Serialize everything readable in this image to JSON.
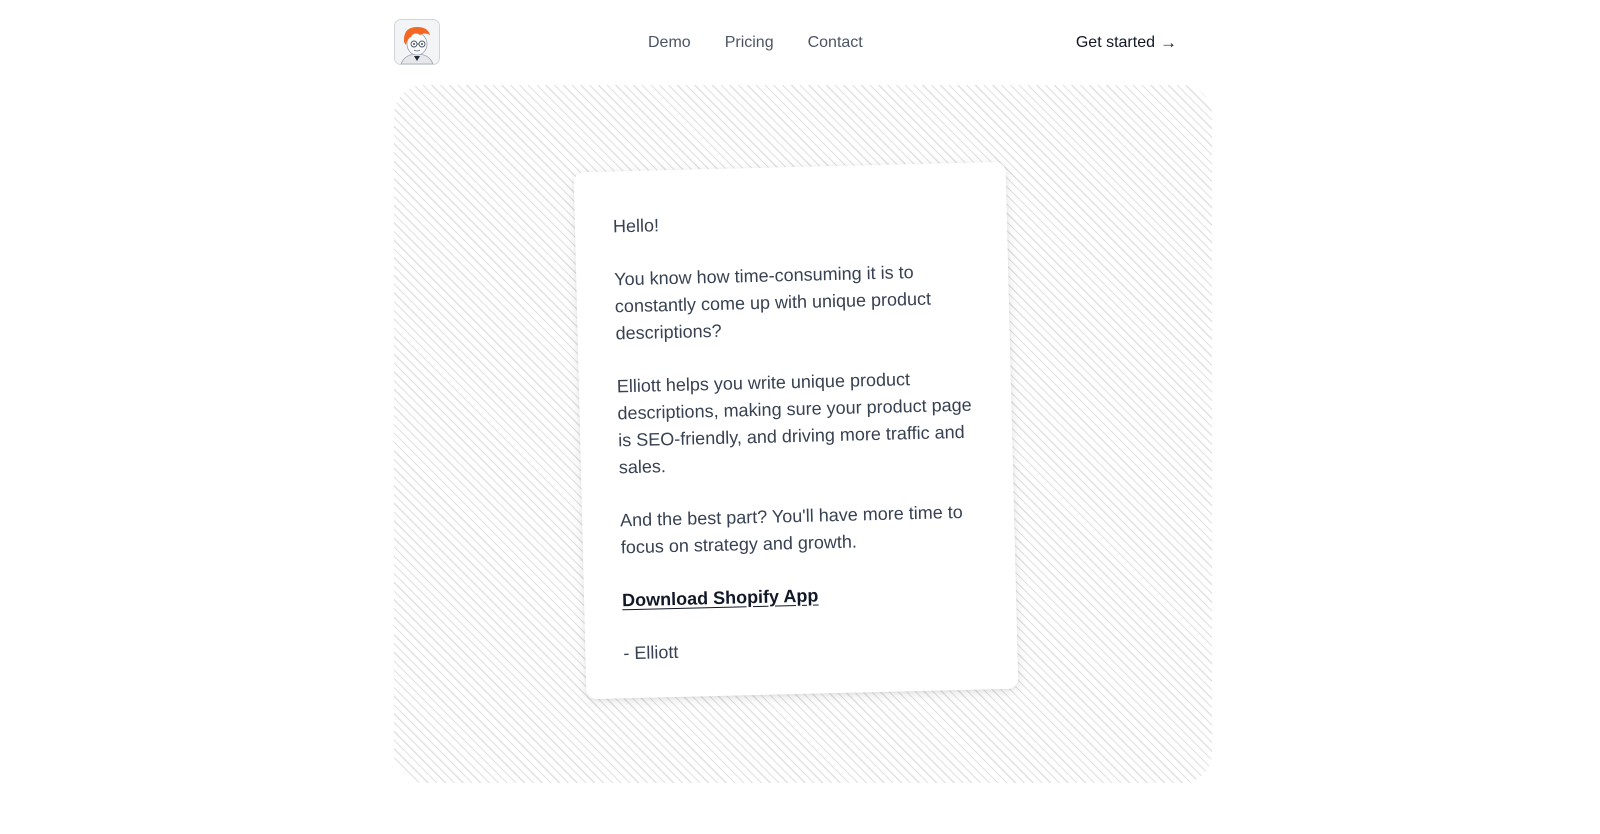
{
  "nav": {
    "logo_alt": "Elliott avatar",
    "links": [
      {
        "label": "Demo"
      },
      {
        "label": "Pricing"
      },
      {
        "label": "Contact"
      }
    ],
    "cta_label": "Get started",
    "cta_arrow": "→"
  },
  "letter": {
    "greeting": "Hello!",
    "paragraph_1": "You know how time-consuming it is to constantly come up with unique product descriptions?",
    "paragraph_2": "Elliott helps you write unique product descriptions, making sure your product page is SEO-friendly, and driving more traffic and sales.",
    "paragraph_3": "And the best part? You'll have more time to focus on strategy and growth.",
    "download_link": "Download Shopify App",
    "signature": "- Elliott"
  },
  "colors": {
    "logo_hair": "#f26722",
    "text": "#374151",
    "nav_text": "#4b5563"
  }
}
